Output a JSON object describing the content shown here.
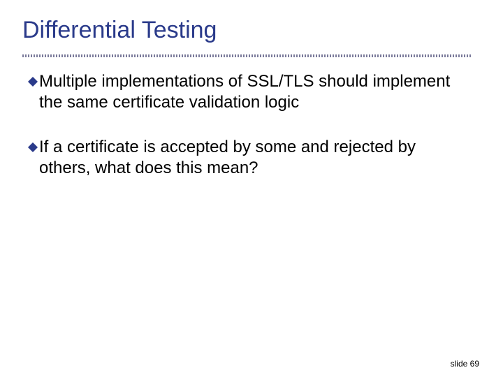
{
  "title": "Differential Testing",
  "bullets": [
    {
      "text": "Multiple implementations of SSL/TLS should implement the same certificate validation logic"
    },
    {
      "text": "If a certificate is accepted by some and rejected by others, what does this mean?"
    }
  ],
  "footer": {
    "label": "slide 69"
  },
  "colors": {
    "title": "#2a3a8a",
    "bullet_fill": "#2a3a8a"
  }
}
